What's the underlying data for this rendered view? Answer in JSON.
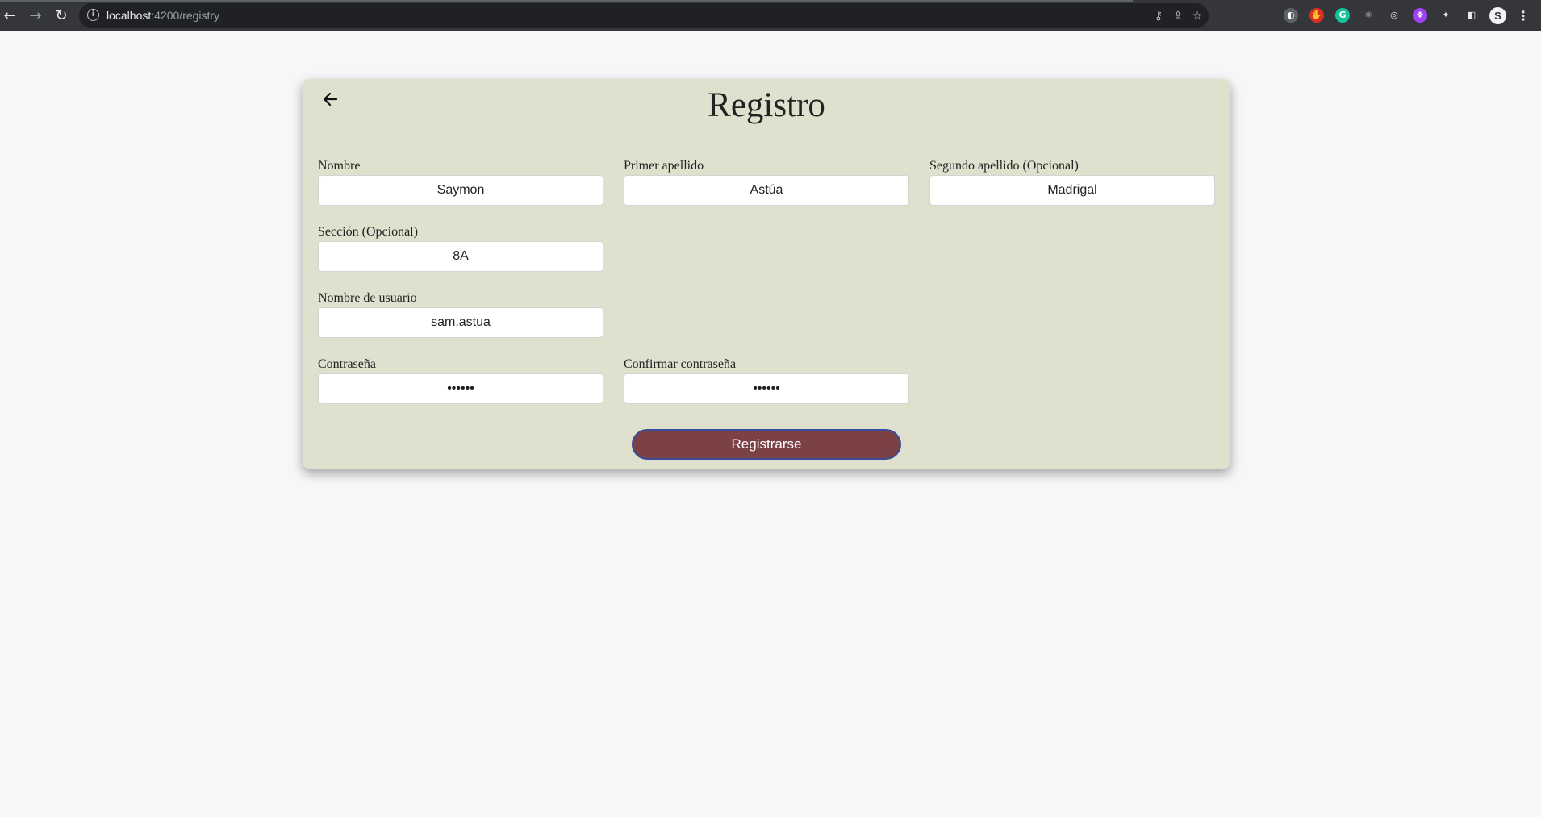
{
  "browser": {
    "url_host": "localhost",
    "url_path": ":4200/registry"
  },
  "page": {
    "title": "Registro",
    "submit_label": "Registrarse"
  },
  "form": {
    "nombre": {
      "label": "Nombre",
      "value": "Saymon"
    },
    "primer_apellido": {
      "label": "Primer apellido",
      "value": "Astúa"
    },
    "segundo_apellido": {
      "label": "Segundo apellido (Opcional)",
      "value": "Madrigal"
    },
    "seccion": {
      "label": "Sección (Opcional)",
      "value": "8A"
    },
    "usuario": {
      "label": "Nombre de usuario",
      "value": "sam.astua"
    },
    "contrasena": {
      "label": "Contraseña",
      "value": "••••••"
    },
    "confirmar": {
      "label": "Confirmar contraseña",
      "value": "••••••"
    }
  },
  "colors": {
    "card_background": "#dfe0cd",
    "button_background": "#7b4145",
    "button_border": "#3a4b9a",
    "page_background": "#f7f7f9"
  }
}
